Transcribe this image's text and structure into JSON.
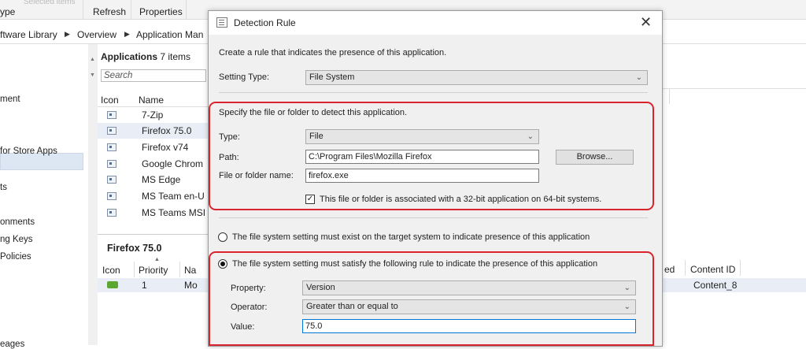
{
  "ribbon": {
    "left_partial": "ype",
    "refresh_label": "Refresh",
    "properties_label": "Properties",
    "faint_label": "Selected items"
  },
  "breadcrumb": {
    "items": [
      "ftware Library",
      "Overview",
      "Application Man"
    ]
  },
  "left_nav": {
    "items": [
      "ment",
      "for Store Apps",
      "ts",
      "onments",
      "ng Keys",
      "Policies",
      "eages"
    ]
  },
  "applications": {
    "title": "Applications",
    "count": "7 items",
    "search_placeholder": "Search",
    "columns": [
      "Icon",
      "Name"
    ],
    "rows": [
      "7-Zip",
      "Firefox 75.0",
      "Firefox v74",
      "Google Chrom",
      "MS Edge",
      "MS Team en-U",
      "MS Teams MSI"
    ]
  },
  "details": {
    "title": "Firefox 75.0",
    "columns": [
      "Icon",
      "Priority",
      "Na"
    ],
    "row": {
      "priority": "1",
      "name": "Mo"
    }
  },
  "right_columns": {
    "partial_col": "ed",
    "content_id_label": "Content ID",
    "content_id_value": "Content_8"
  },
  "dialog": {
    "title": "Detection Rule",
    "intro": "Create a rule that indicates the presence of this application.",
    "setting_type_label": "Setting Type:",
    "setting_type_value": "File System",
    "section1": {
      "heading": "Specify the file or folder to detect this application.",
      "type_label": "Type:",
      "type_value": "File",
      "path_label": "Path:",
      "path_value": "C:\\Program Files\\Mozilla Firefox",
      "browse_label": "Browse...",
      "filename_label": "File or folder name:",
      "filename_value": "firefox.exe",
      "checkbox_label": "This file or folder is associated with a 32-bit application on 64-bit systems.",
      "checkbox_checked": true
    },
    "radio_exist_label": "The file system setting must exist on the target system to indicate presence of this application",
    "radio_rule_label": "The file system setting must satisfy the following rule to indicate the presence of this application",
    "selected_radio": "rule",
    "section2": {
      "property_label": "Property:",
      "property_value": "Version",
      "operator_label": "Operator:",
      "operator_value": "Greater than or equal to",
      "value_label": "Value:",
      "value_value": "75.0"
    }
  },
  "colors": {
    "highlight_red": "#d9232d",
    "selection_blue": "#dde7f3",
    "focus_blue": "#0078d7"
  }
}
